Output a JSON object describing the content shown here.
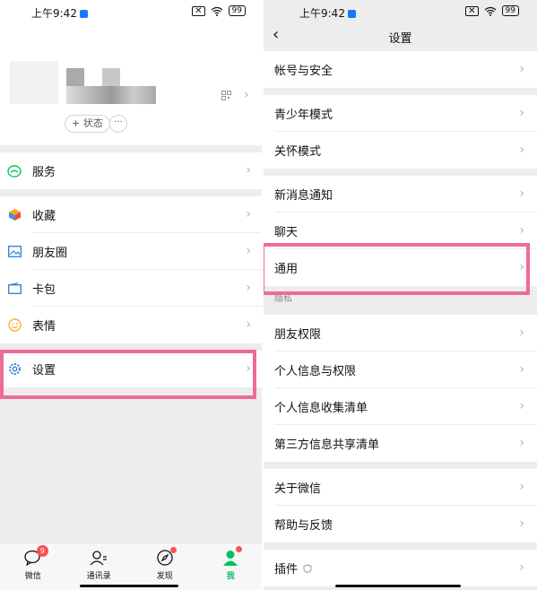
{
  "status": {
    "time": "上午9:42",
    "battery": "99"
  },
  "profile": {
    "status_button": "+ 状态",
    "more_button": "···"
  },
  "menu": [
    {
      "label": "服务",
      "icon": "wallet-icon"
    },
    {
      "label": "收藏",
      "icon": "cube-icon"
    },
    {
      "label": "朋友圈",
      "icon": "image-icon"
    },
    {
      "label": "卡包",
      "icon": "card-icon"
    },
    {
      "label": "表情",
      "icon": "smiley-icon"
    },
    {
      "label": "设置",
      "icon": "gear-icon"
    }
  ],
  "tabs": [
    {
      "label": "微信",
      "badge": "9"
    },
    {
      "label": "通讯录"
    },
    {
      "label": "发现"
    },
    {
      "label": "我"
    }
  ],
  "settings": {
    "title": "设置",
    "groups": [
      [
        "帐号与安全"
      ],
      [
        "青少年模式",
        "关怀模式"
      ],
      [
        "新消息通知",
        "聊天",
        "通用"
      ]
    ],
    "privacy_header": "隐私",
    "privacy": [
      "朋友权限",
      "个人信息与权限",
      "个人信息收集清单",
      "第三方信息共享清单"
    ],
    "about": [
      "关于微信",
      "帮助与反馈"
    ],
    "plugins": "插件"
  },
  "colors": {
    "accent": "#07c160",
    "highlight": "#ee6b97"
  }
}
